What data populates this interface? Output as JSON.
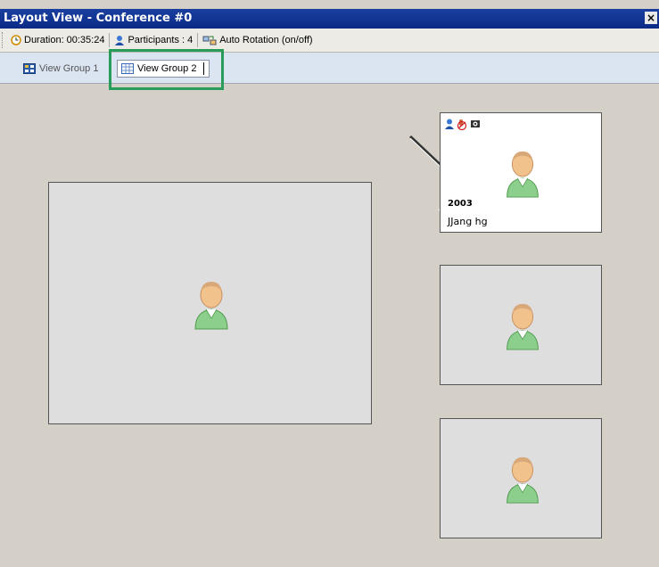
{
  "window": {
    "title": "Layout View - Conference #0",
    "close_label": "×"
  },
  "toolbar": {
    "duration_label": "Duration:",
    "duration_value": "00:35:24",
    "participants_label": "Participants :",
    "participants_value": "4",
    "auto_rotation_label": "Auto Rotation (on/off)"
  },
  "tabs": [
    {
      "label": "View Group 1",
      "selected": false
    },
    {
      "label": "View Group 2",
      "selected": true
    }
  ],
  "participants": [
    {
      "id": "2003",
      "name": "JJang hg"
    }
  ],
  "colors": {
    "highlight": "#2a9c5a",
    "titlebar": "#0a2a86"
  }
}
